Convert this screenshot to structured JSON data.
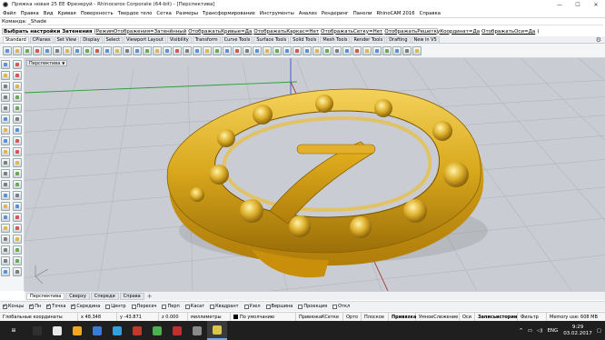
{
  "window": {
    "title": "Пряжка новая 25 ЕЕ Фрезеруй - Rhinoceros Corporate (64-bit) - [Перспектива]",
    "minimize": "—",
    "maximize": "☐",
    "close": "✕"
  },
  "menu": [
    "Файл",
    "Правка",
    "Вид",
    "Кривая",
    "Поверхность",
    "Твердое тело",
    "Сетка",
    "Размеры",
    "Трансформирование",
    "Инструменты",
    "Анализ",
    "Рендеринг",
    "Панели",
    "RhinoCAM 2016",
    "Справка"
  ],
  "command": {
    "history": "Команда: _Shade",
    "prompt_label": "Выбрать настройки Затенения",
    "options": [
      "РежимОтображения=Затенённый",
      "ОтображатьКривые=Да",
      "ОтображатьКаркас=Нет",
      "ОтображатьСетку=Нет",
      "ОтображатьРешеткуКоординат=Да",
      "ОтображатьОси=Да",
      ")"
    ]
  },
  "toolbar_tabs": [
    "Standard",
    "CPlanes",
    "Set View",
    "Display",
    "Select",
    "Viewport Layout",
    "Visibility",
    "Transform",
    "Curve Tools",
    "Surface Tools",
    "Solid Tools",
    "Mesh Tools",
    "Render Tools",
    "Drafting",
    "New in V5"
  ],
  "toolbar_icon_colors": [
    "#5b8fd6",
    "#e2b54a",
    "#6aaa4c",
    "#d9534f",
    "#5b8fd6",
    "#7d7d7d",
    "#e2b54a",
    "#5b8fd6",
    "#6aaa4c",
    "#d9534f",
    "#5b8fd6",
    "#e2b54a",
    "#7d7d7d",
    "#5b8fd6",
    "#6aaa4c",
    "#e2b54a",
    "#5b8fd6",
    "#d9534f",
    "#7d7d7d",
    "#5b8fd6",
    "#e2b54a",
    "#6aaa4c",
    "#5b8fd6",
    "#d9534f",
    "#7d7d7d",
    "#5b8fd6",
    "#e2b54a",
    "#6aaa4c",
    "#5b8fd6",
    "#d9534f",
    "#5b8fd6",
    "#e2b54a",
    "#6aaa4c",
    "#7d7d7d",
    "#5b8fd6",
    "#d9534f",
    "#e2b54a",
    "#5b8fd6",
    "#6aaa4c",
    "#5b8fd6",
    "#7d7d7d",
    "#e2b54a"
  ],
  "viewport": {
    "label": "Перспектива",
    "caret": "▼"
  },
  "view_tabs": [
    "Перспектива",
    "Сверху",
    "Спереди",
    "Справа"
  ],
  "osnaps": [
    {
      "label": "Концы",
      "checked": true
    },
    {
      "label": "Пн",
      "checked": true
    },
    {
      "label": "Точка",
      "checked": true
    },
    {
      "label": "Середина",
      "checked": true
    },
    {
      "label": "Центр",
      "checked": false
    },
    {
      "label": "Пересеч",
      "checked": false
    },
    {
      "label": "Перп",
      "checked": false
    },
    {
      "label": "Касат",
      "checked": false
    },
    {
      "label": "Квадрант",
      "checked": false
    },
    {
      "label": "Узел",
      "checked": false
    },
    {
      "label": "Вершина",
      "checked": false
    },
    {
      "label": "Проекция",
      "checked": false
    },
    {
      "label": "Откл",
      "checked": false
    }
  ],
  "status": {
    "cplane": "Глобальные координаты",
    "x": "x 48.348",
    "y": "y -43.871",
    "z": "z 0.000",
    "units": "миллиметры",
    "layer": "По умолчанию",
    "grid_snap": "ПривязкаКСетке",
    "ortho": "Орто",
    "planar": "Плоское",
    "osnap": "Привязка",
    "smarttrack": "УмноеСлежение",
    "gumball": "Оси",
    "history": "Записьистории",
    "filter": "Фильтр",
    "memory": "Memory use: 608 MB"
  },
  "taskbar": {
    "start": "⊞",
    "apps": [
      "#2f2f2f",
      "#e8e8e8",
      "#f4a623",
      "#3a7bd5",
      "#2fa1e0",
      "#c0392b",
      "#4caf50",
      "#c03030",
      "#8a8a8a",
      "#d9c64a"
    ],
    "tray_lang": "ENG",
    "tray_chevron": "^",
    "time": "9:29",
    "date": "03.02.2017"
  }
}
